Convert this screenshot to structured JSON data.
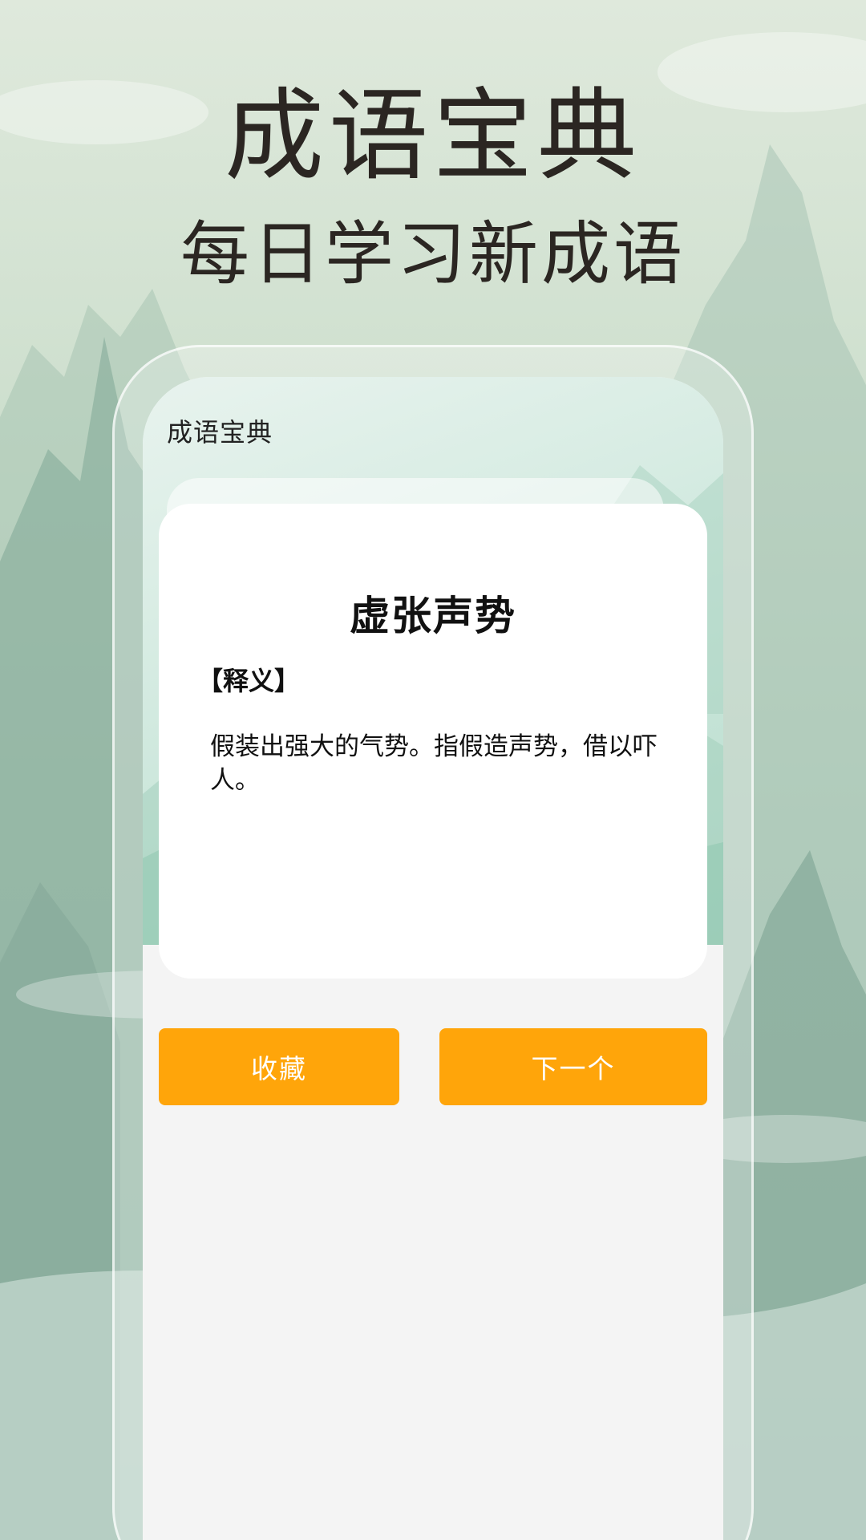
{
  "promo": {
    "title": "成语宝典",
    "subtitle": "每日学习新成语"
  },
  "app": {
    "title": "成语宝典"
  },
  "card": {
    "idiom": "虚张声势",
    "definition_label": "【释义】",
    "definition": "假装出强大的气势。指假造声势，借以吓人。"
  },
  "buttons": {
    "favorite_label": "收藏",
    "next_label": "下一个"
  },
  "colors": {
    "accent": "#ffa50a",
    "card": "#ffffff",
    "screen_bg": "#f4f4f4"
  }
}
